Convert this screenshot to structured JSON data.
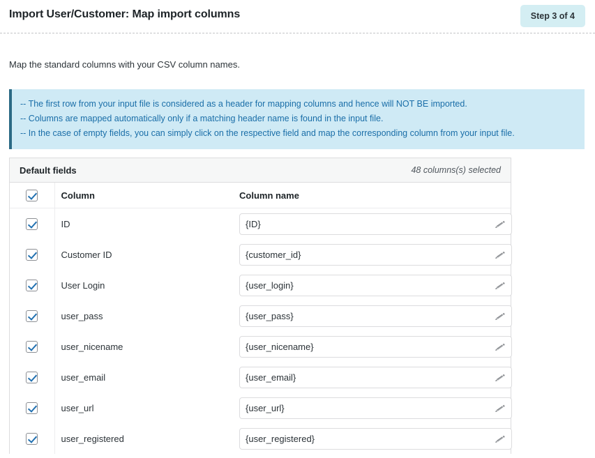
{
  "header": {
    "title": "Import User/Customer: Map import columns",
    "step_badge": "Step 3 of 4",
    "badge_color": "#d4eef3"
  },
  "intro": {
    "text": "Map the standard columns with your CSV column names."
  },
  "notice": {
    "accent_color": "#2b6a85",
    "background_color": "#cfeaf5",
    "text_color": "#1a6ea8",
    "lines": [
      "-- The first row from your input file is considered as a header for mapping columns and hence will NOT BE imported.",
      "-- Columns are mapped automatically only if a matching header name is found in the input file.",
      "-- In the case of empty fields, you can simply click on the respective field and map the corresponding column from your input file."
    ]
  },
  "card": {
    "title": "Default fields",
    "count_label": "48 columns(s) selected",
    "columns": {
      "column": "Column",
      "column_name": "Column name"
    },
    "select_all_checked": true,
    "rows": [
      {
        "checked": true,
        "column": "ID",
        "column_name": "{ID}"
      },
      {
        "checked": true,
        "column": "Customer ID",
        "column_name": "{customer_id}"
      },
      {
        "checked": true,
        "column": "User Login",
        "column_name": "{user_login}"
      },
      {
        "checked": true,
        "column": "user_pass",
        "column_name": "{user_pass}"
      },
      {
        "checked": true,
        "column": "user_nicename",
        "column_name": "{user_nicename}"
      },
      {
        "checked": true,
        "column": "user_email",
        "column_name": "{user_email}"
      },
      {
        "checked": true,
        "column": "user_url",
        "column_name": "{user_url}"
      },
      {
        "checked": true,
        "column": "user_registered",
        "column_name": "{user_registered}"
      }
    ],
    "edit_icon": "pencil-icon"
  }
}
